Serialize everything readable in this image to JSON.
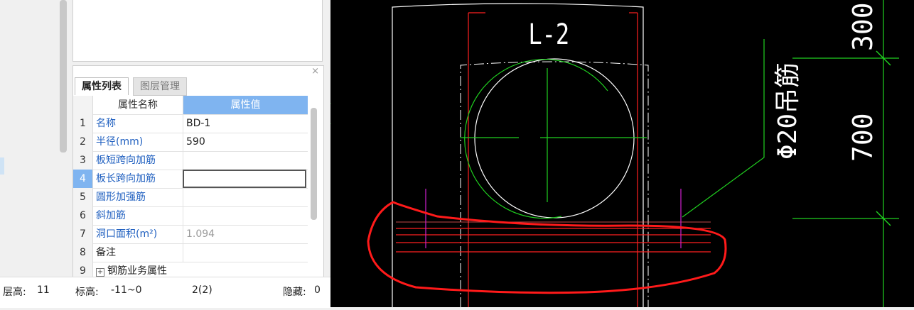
{
  "panel": {
    "tabs": [
      "属性列表",
      "图层管理"
    ],
    "close_symbol": "×",
    "columns": [
      "属性名称",
      "属性值"
    ],
    "rows": [
      {
        "num": "1",
        "name": "名称",
        "value": "BD-1"
      },
      {
        "num": "2",
        "name": "半径(mm)",
        "value": "590"
      },
      {
        "num": "3",
        "name": "板短跨向加筋",
        "value": ""
      },
      {
        "num": "4",
        "name": "板长跨向加筋",
        "value": ""
      },
      {
        "num": "5",
        "name": "圆形加强筋",
        "value": ""
      },
      {
        "num": "6",
        "name": "斜加筋",
        "value": ""
      },
      {
        "num": "7",
        "name": "洞口面积(m²)",
        "value": "1.094"
      },
      {
        "num": "8",
        "name": "备注",
        "value": ""
      },
      {
        "num": "9",
        "name": "钢筋业务属性",
        "value": ""
      }
    ],
    "selected_row": "4"
  },
  "status": {
    "floor_height_label": "层高:",
    "floor_height": "11",
    "elevation_label": "标高:",
    "elevation": "-11~0",
    "count": "2(2)",
    "hidden_label": "隐藏:",
    "hidden": "0"
  },
  "cad": {
    "beam_label": "L-2",
    "rebar_label": "Φ20吊筋",
    "dim_top": "300",
    "dim_mid": "700",
    "colors": {
      "white": "#ffffff",
      "red": "#ff2020",
      "green": "#20d020",
      "magenta": "#d020d0",
      "markup": "#ff1a1a"
    }
  }
}
